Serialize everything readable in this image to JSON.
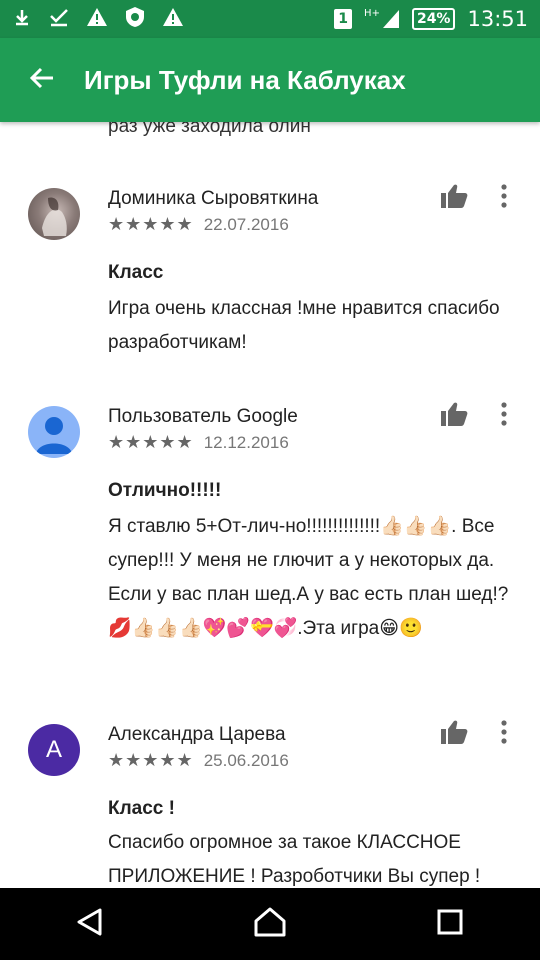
{
  "status_bar": {
    "left_icons": [
      "download-icon",
      "check-icon",
      "warning-icon",
      "shield-icon",
      "warning-icon"
    ],
    "sim": "1",
    "network": "H+",
    "battery": "24%",
    "time": "13:51"
  },
  "app_bar": {
    "title": "Игры Туфли на Каблуках",
    "back_icon": "arrow-back-icon"
  },
  "partial_text": "раз уже заходила олин",
  "reviews": [
    {
      "name": "Доминика Сыровяткина",
      "stars": "★★★★★",
      "rating": 5,
      "date": "22.07.2016",
      "title": "Класс",
      "body": "Игра очень классная !мне нравится спасибо разработчикам!",
      "avatar": "photo"
    },
    {
      "name": "Пользователь Google",
      "stars": "★★★★★",
      "rating": 5,
      "date": "12.12.2016",
      "title": "Отлично!!!!!",
      "body": "Я ставлю 5+От-лич-но!!!!!!!!!!!!!!👍🏻👍🏻👍🏻. Все супер!!! У меня не глючит а у некоторых да. Если у вас план шед.А у вас есть план шед!?💋👍🏻👍🏻👍🏻💖💕💝💞.Эта игра😁🙂",
      "avatar": "google"
    },
    {
      "name": "Александра Царева",
      "stars": "★★★★★",
      "rating": 5,
      "date": "25.06.2016",
      "title": "Класс !",
      "body": "Спасибо огромное за такое КЛАССНОЕ ПРИЛОЖЕНИЕ ! Разроботчики Вы супер !",
      "avatar": "letter",
      "avatar_letter": "А"
    }
  ],
  "colors": {
    "status_bar": "#1a8a4a",
    "app_bar": "#1f9d55",
    "letter_avatar": "#4b2aa3"
  }
}
